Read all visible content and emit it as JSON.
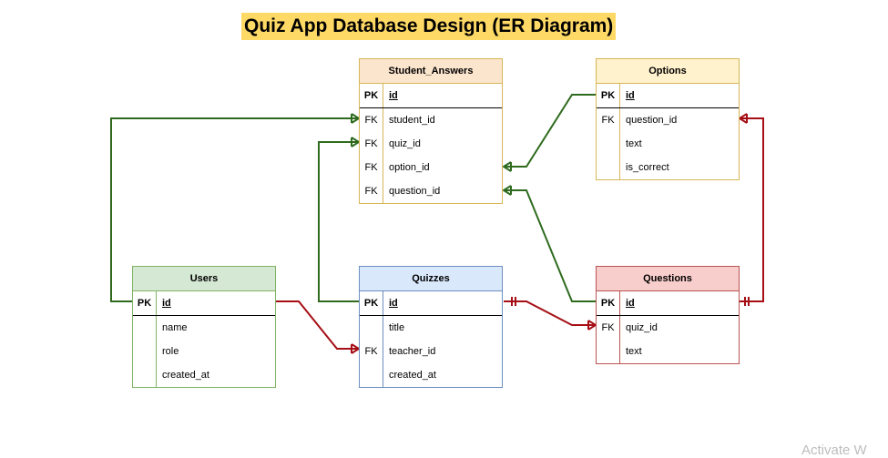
{
  "title": "Quiz App Database Design (ER Diagram)",
  "watermark": "Activate W",
  "colors": {
    "green_line": "#2e6b1e",
    "red_line": "#a50f15"
  },
  "entities": {
    "student_answers": {
      "name": "Student_Answers",
      "header_color": "#fce5cd",
      "border_color": "#d6b656",
      "rows": [
        {
          "key": "PK",
          "field": "id"
        },
        {
          "key": "FK",
          "field": "student_id"
        },
        {
          "key": "FK",
          "field": "quiz_id"
        },
        {
          "key": "FK",
          "field": "option_id"
        },
        {
          "key": "FK",
          "field": "question_id"
        }
      ]
    },
    "options": {
      "name": "Options",
      "header_color": "#fff2cc",
      "border_color": "#d6b656",
      "rows": [
        {
          "key": "PK",
          "field": "id"
        },
        {
          "key": "FK",
          "field": "question_id"
        },
        {
          "key": "",
          "field": "text"
        },
        {
          "key": "",
          "field": "is_correct"
        }
      ]
    },
    "users": {
      "name": "Users",
      "header_color": "#d5e8d4",
      "border_color": "#82b366",
      "rows": [
        {
          "key": "PK",
          "field": "id"
        },
        {
          "key": "",
          "field": "name"
        },
        {
          "key": "",
          "field": "role"
        },
        {
          "key": "",
          "field": "created_at"
        }
      ]
    },
    "quizzes": {
      "name": "Quizzes",
      "header_color": "#dae8fc",
      "border_color": "#6c8ebf",
      "rows": [
        {
          "key": "PK",
          "field": "id"
        },
        {
          "key": "",
          "field": "title"
        },
        {
          "key": "FK",
          "field": "teacher_id"
        },
        {
          "key": "",
          "field": "created_at"
        }
      ]
    },
    "questions": {
      "name": "Questions",
      "header_color": "#f8cecc",
      "border_color": "#b85450",
      "rows": [
        {
          "key": "PK",
          "field": "id"
        },
        {
          "key": "FK",
          "field": "quiz_id"
        },
        {
          "key": "",
          "field": "text"
        }
      ]
    }
  }
}
